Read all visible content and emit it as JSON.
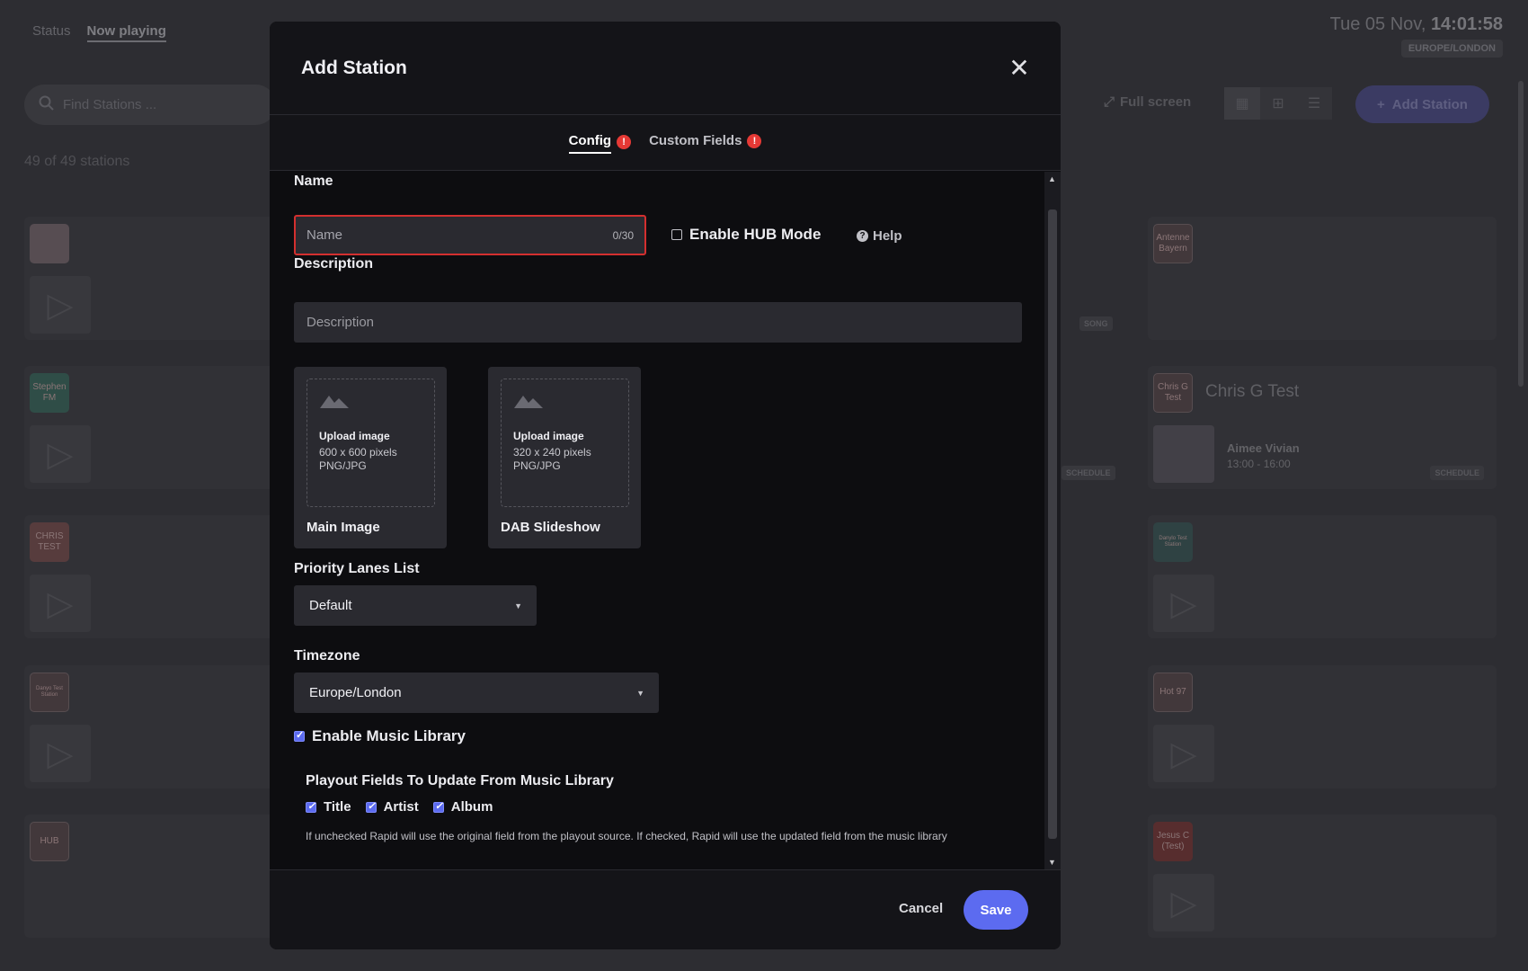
{
  "background": {
    "nav": [
      "Status",
      "Now playing"
    ],
    "clock": {
      "date": "Tue 05 Nov,",
      "time": "14:01:58",
      "timezone": "EUROPE/LONDON"
    },
    "search_placeholder": "Find Stations ...",
    "count": "49 of 49 stations",
    "fullscreen": "Full screen",
    "add_station": "Add Station",
    "cards": [
      {
        "logo": ""
      },
      {
        "logo": "Antenne Bayern",
        "tag": "SONG"
      },
      {
        "logo": "Stephen FM"
      },
      {
        "logo": "Chris G Test",
        "title": "Chris G Test",
        "show": "Aimee Vivian",
        "show_time": "13:00 - 16:00",
        "tag": "SCHEDULE"
      },
      {
        "logo": "CHRIS TEST"
      },
      {
        "logo": "Danylo Test Station"
      },
      {
        "logo": "Danyo Test Station"
      },
      {
        "logo": "Hot 97"
      },
      {
        "logo": "HUB"
      },
      {
        "logo": "Jesus C (Test)"
      }
    ],
    "left_tag": "SCHEDULE"
  },
  "modal": {
    "title": "Add Station",
    "tabs": [
      {
        "label": "Config"
      },
      {
        "label": "Custom Fields"
      }
    ],
    "name": {
      "label": "Name",
      "placeholder": "Name",
      "counter": "0/30"
    },
    "hub_mode": "Enable HUB Mode",
    "help": "Help",
    "description": {
      "label": "Description",
      "placeholder": "Description"
    },
    "uploads": [
      {
        "title": "Upload image",
        "size": "600 x 600 pixels",
        "format": "PNG/JPG",
        "caption": "Main Image"
      },
      {
        "title": "Upload image",
        "size": "320 x 240 pixels",
        "format": "PNG/JPG",
        "caption": "DAB Slideshow"
      }
    ],
    "priority": {
      "label": "Priority Lanes List",
      "value": "Default"
    },
    "timezone": {
      "label": "Timezone",
      "value": "Europe/London"
    },
    "music_library": "Enable Music Library",
    "playout": {
      "title": "Playout Fields To Update From Music Library",
      "options": [
        "Title",
        "Artist",
        "Album"
      ],
      "note": "If unchecked Rapid will use the original field from the playout source. If checked, Rapid will use the updated field from the music library"
    },
    "cancel": "Cancel",
    "save": "Save"
  },
  "colors": {
    "accent": "#5c6bf0",
    "error": "#e53935"
  }
}
